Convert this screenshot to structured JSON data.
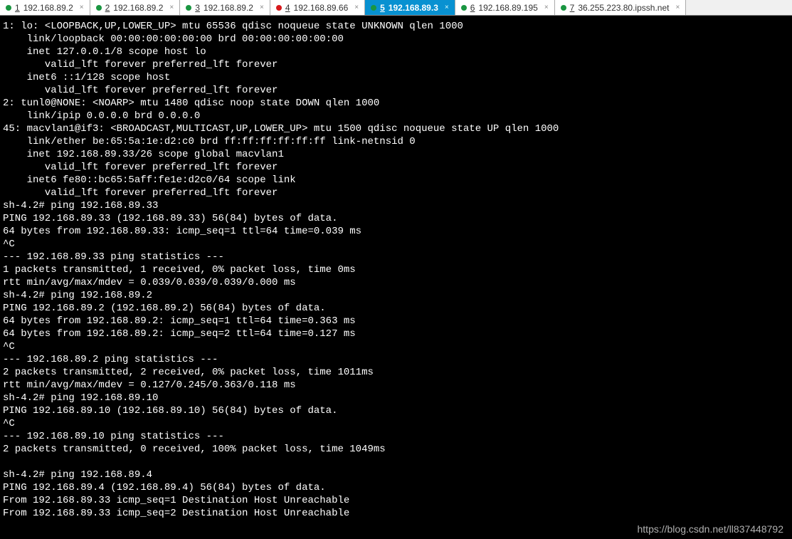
{
  "tabs": [
    {
      "num": "1",
      "ip": "192.168.89.2",
      "dot": "dot-green",
      "active": false
    },
    {
      "num": "2",
      "ip": "192.168.89.2",
      "dot": "dot-green",
      "active": false
    },
    {
      "num": "3",
      "ip": "192.168.89.2",
      "dot": "dot-green",
      "active": false
    },
    {
      "num": "4",
      "ip": "192.168.89.66",
      "dot": "dot-red",
      "active": false
    },
    {
      "num": "5",
      "ip": "192.168.89.3",
      "dot": "dot-green",
      "active": true
    },
    {
      "num": "6",
      "ip": "192.168.89.195",
      "dot": "dot-green",
      "active": false
    },
    {
      "num": "7",
      "ip": "36.255.223.80.ipssh.net",
      "dot": "dot-green",
      "active": false
    }
  ],
  "terminal_lines": [
    "1: lo: <LOOPBACK,UP,LOWER_UP> mtu 65536 qdisc noqueue state UNKNOWN qlen 1000",
    "    link/loopback 00:00:00:00:00:00 brd 00:00:00:00:00:00",
    "    inet 127.0.0.1/8 scope host lo",
    "       valid_lft forever preferred_lft forever",
    "    inet6 ::1/128 scope host ",
    "       valid_lft forever preferred_lft forever",
    "2: tunl0@NONE: <NOARP> mtu 1480 qdisc noop state DOWN qlen 1000",
    "    link/ipip 0.0.0.0 brd 0.0.0.0",
    "45: macvlan1@if3: <BROADCAST,MULTICAST,UP,LOWER_UP> mtu 1500 qdisc noqueue state UP qlen 1000",
    "    link/ether be:65:5a:1e:d2:c0 brd ff:ff:ff:ff:ff:ff link-netnsid 0",
    "    inet 192.168.89.33/26 scope global macvlan1",
    "       valid_lft forever preferred_lft forever",
    "    inet6 fe80::bc65:5aff:fe1e:d2c0/64 scope link ",
    "       valid_lft forever preferred_lft forever",
    "sh-4.2# ping 192.168.89.33",
    "PING 192.168.89.33 (192.168.89.33) 56(84) bytes of data.",
    "64 bytes from 192.168.89.33: icmp_seq=1 ttl=64 time=0.039 ms",
    "^C",
    "--- 192.168.89.33 ping statistics ---",
    "1 packets transmitted, 1 received, 0% packet loss, time 0ms",
    "rtt min/avg/max/mdev = 0.039/0.039/0.039/0.000 ms",
    "sh-4.2# ping 192.168.89.2",
    "PING 192.168.89.2 (192.168.89.2) 56(84) bytes of data.",
    "64 bytes from 192.168.89.2: icmp_seq=1 ttl=64 time=0.363 ms",
    "64 bytes from 192.168.89.2: icmp_seq=2 ttl=64 time=0.127 ms",
    "^C",
    "--- 192.168.89.2 ping statistics ---",
    "2 packets transmitted, 2 received, 0% packet loss, time 1011ms",
    "rtt min/avg/max/mdev = 0.127/0.245/0.363/0.118 ms",
    "sh-4.2# ping 192.168.89.10",
    "PING 192.168.89.10 (192.168.89.10) 56(84) bytes of data.",
    "^C",
    "--- 192.168.89.10 ping statistics ---",
    "2 packets transmitted, 0 received, 100% packet loss, time 1049ms",
    "",
    "sh-4.2# ping 192.168.89.4",
    "PING 192.168.89.4 (192.168.89.4) 56(84) bytes of data.",
    "From 192.168.89.33 icmp_seq=1 Destination Host Unreachable",
    "From 192.168.89.33 icmp_seq=2 Destination Host Unreachable"
  ],
  "watermark": "https://blog.csdn.net/ll837448792"
}
